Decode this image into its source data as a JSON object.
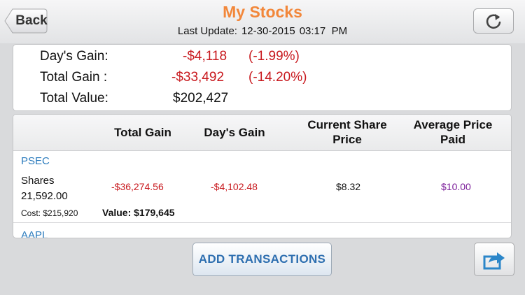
{
  "header": {
    "back_label": "Back",
    "title": "My Stocks",
    "last_update_label": "Last Update:",
    "last_update_date": "12-30-2015",
    "last_update_time": "03:17  PM",
    "refresh_icon": "refresh-icon"
  },
  "summary": {
    "days_gain": {
      "label": "Day's Gain:",
      "value": "-$4,118",
      "pct": "(-1.99%)"
    },
    "total_gain": {
      "label": "Total Gain :",
      "value": "-$33,492",
      "pct": "(-14.20%)"
    },
    "total_value": {
      "label": "Total Value:",
      "value": "$202,427"
    }
  },
  "table": {
    "headers": {
      "total_gain": "Total Gain",
      "days_gain": "Day's Gain",
      "current_price_1": "Current Share",
      "current_price_2": "Price",
      "avg_price_1": "Average Price",
      "avg_price_2": "Paid"
    },
    "rows": [
      {
        "symbol": "PSEC",
        "shares_label": "Shares",
        "shares": "21,592.00",
        "cost": "Cost: $215,920",
        "total_gain": "-$36,274.56",
        "value": "Value: $179,645",
        "days_gain": "-$4,102.48",
        "current_price": "$8.32",
        "avg_price": "$10.00"
      },
      {
        "symbol": "AAPL"
      }
    ]
  },
  "footer": {
    "add_label": "ADD TRANSACTIONS",
    "share_icon": "share-icon"
  },
  "colors": {
    "title": "#f2873a",
    "negative": "#c8191e",
    "symbol": "#2b7bbd",
    "avg_price": "#7b1d99",
    "button_text": "#2e6fb0"
  }
}
